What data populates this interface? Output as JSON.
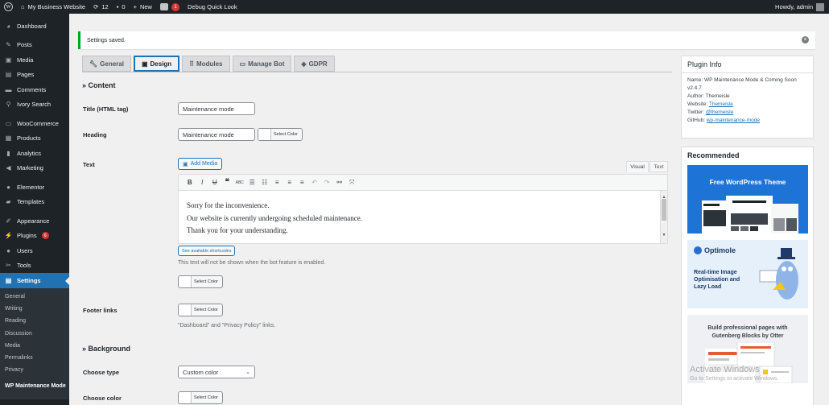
{
  "adminbar": {
    "site_name": "My Business Website",
    "updates_count": "12",
    "comments_count": "0",
    "new_label": "New",
    "yoast_badge": "1",
    "debug_label": "Debug Quick Look",
    "greeting": "Howdy, admin"
  },
  "sidebar": {
    "items": [
      {
        "label": "Dashboard",
        "icon": "dashboard-icon"
      },
      {
        "label": "Posts",
        "icon": "pin-icon"
      },
      {
        "label": "Media",
        "icon": "media-icon"
      },
      {
        "label": "Pages",
        "icon": "page-icon"
      },
      {
        "label": "Comments",
        "icon": "comment-icon"
      },
      {
        "label": "Ivory Search",
        "icon": "search-icon"
      },
      {
        "label": "WooCommerce",
        "icon": "woo-icon"
      },
      {
        "label": "Products",
        "icon": "archive-icon"
      },
      {
        "label": "Analytics",
        "icon": "chart-icon"
      },
      {
        "label": "Marketing",
        "icon": "megaphone-icon"
      },
      {
        "label": "Elementor",
        "icon": "elementor-icon"
      },
      {
        "label": "Templates",
        "icon": "folder-icon"
      },
      {
        "label": "Appearance",
        "icon": "brush-icon"
      },
      {
        "label": "Plugins",
        "icon": "plugin-icon",
        "badge": "6"
      },
      {
        "label": "Users",
        "icon": "users-icon"
      },
      {
        "label": "Tools",
        "icon": "wrench-icon"
      },
      {
        "label": "Settings",
        "icon": "settings-icon"
      }
    ],
    "submenu": [
      "General",
      "Writing",
      "Reading",
      "Discussion",
      "Media",
      "Permalinks",
      "Privacy",
      "WP Maintenance Mode"
    ]
  },
  "notice": {
    "text": "Settings saved."
  },
  "tabs": [
    {
      "label": "General",
      "icon": "wrench-icon"
    },
    {
      "label": "Design",
      "icon": "layout-icon"
    },
    {
      "label": "Modules",
      "icon": "modules-icon"
    },
    {
      "label": "Manage Bot",
      "icon": "chat-icon"
    },
    {
      "label": "GDPR",
      "icon": "shield-icon"
    }
  ],
  "content_section": {
    "title": "» Content",
    "title_label": "Title (HTML tag)",
    "title_value": "Maintenance mode",
    "heading_label": "Heading",
    "heading_value": "Maintenance mode",
    "select_color": "Select Color",
    "text_label": "Text",
    "add_media": "Add Media",
    "editor_tab_visual": "Visual",
    "editor_tab_text": "Text",
    "editor_lines": [
      "Sorry for the inconvenience.",
      "Our website is currently undergoing scheduled maintenance.",
      "Thank you for your understanding."
    ],
    "shortcodes_button": "See available shortcodes",
    "bot_note": "This text will not be shown when the bot feature is enabled.",
    "footer_label": "Footer links",
    "footer_note": "\"Dashboard\" and \"Privacy Policy\" links."
  },
  "background_section": {
    "title": "» Background",
    "choose_type_label": "Choose type",
    "choose_type_value": "Custom color",
    "choose_color_label": "Choose color"
  },
  "plugin_info": {
    "title": "Plugin Info",
    "name": "Name: WP Maintenance Mode & Coming Soon",
    "version": "v2.4.7",
    "author": "Author: Themeisle",
    "website_label": "Website: ",
    "website_link": "Themeisle",
    "twitter_label": "Twitter: ",
    "twitter_link": "@themeisle",
    "github_label": "GitHub: ",
    "github_link": "wp-maintenance-mode"
  },
  "recommended": {
    "title": "Recommended",
    "card1_title": "Free WordPress Theme",
    "card2_brand": "Optimole",
    "card2_text": [
      "Real-time Image",
      "Optimisation and",
      "Lazy Load"
    ],
    "card3_text": [
      "Build professional pages with",
      "Gutenberg Blocks by Otter"
    ]
  },
  "watermark": {
    "title": "Activate Windows",
    "subtitle": "Go to Settings to activate Windows."
  },
  "colors": {
    "admin_bg": "#1d2327",
    "accent": "#2271b1",
    "success": "#00a32a",
    "badge": "#d63638"
  }
}
